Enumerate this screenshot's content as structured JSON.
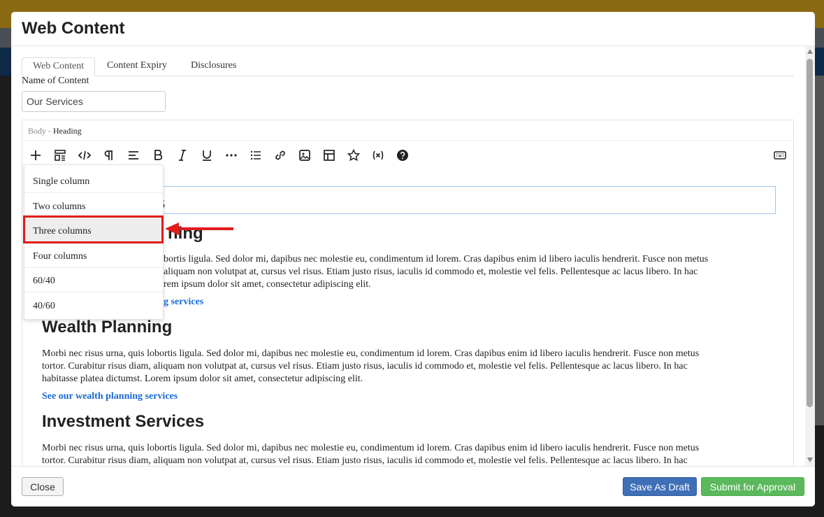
{
  "modal": {
    "title": "Web Content"
  },
  "tabs": [
    {
      "label": "Web Content",
      "active": true
    },
    {
      "label": "Content Expiry",
      "active": false
    },
    {
      "label": "Disclosures",
      "active": false
    }
  ],
  "form": {
    "name_label": "Name of Content",
    "name_value": "Our Services"
  },
  "editor": {
    "crumb_root": "Body",
    "crumb_sep": "-",
    "crumb_current": "Heading",
    "toolbar_icons": [
      "plus-icon",
      "layout-icon",
      "code-icon",
      "paragraph-icon",
      "align-icon",
      "bold-icon",
      "italic-icon",
      "underline-icon",
      "more-icon",
      "list-icon",
      "link-icon",
      "image-icon",
      "table-icon",
      "star-icon",
      "variable-icon",
      "help-icon",
      "keyboard-icon"
    ]
  },
  "content": {
    "heading_fragment": "s",
    "section1_heading_fragment": "ning",
    "section1_para_lines": [
      "bortis ligula. Sed dolor mi, dapibus nec molestie eu, condimentum id lorem. Cras dapibus enim id libero iaculis hendrerit. Fusce non metus",
      "aliquam non volutpat at, cursus vel risus. Etiam justo risus, iaculis id commodo et, molestie vel felis. Pellentesque ac lacus libero. In hac",
      "rem ipsum dolor sit amet, consectetur adipiscing elit."
    ],
    "section1_link_fragment": "g services",
    "section2_heading": "Wealth Planning",
    "section2_para_lines": [
      "Morbi nec risus urna, quis lobortis ligula. Sed dolor mi, dapibus nec molestie eu, condimentum id lorem. Cras dapibus enim id libero iaculis hendrerit. Fusce non metus",
      "tortor. Curabitur risus diam, aliquam non volutpat at, cursus vel risus. Etiam justo risus, iaculis id commodo et, molestie vel felis. Pellentesque ac lacus libero. In hac",
      "habitasse platea dictumst. Lorem ipsum dolor sit amet, consectetur adipiscing elit."
    ],
    "section2_link": "See our wealth planning services",
    "section3_heading": "Investment Services",
    "section3_para_lines": [
      "Morbi nec risus urna, quis lobortis ligula. Sed dolor mi, dapibus nec molestie eu, condimentum id lorem. Cras dapibus enim id libero iaculis hendrerit. Fusce non metus",
      "tortor. Curabitur risus diam, aliquam non volutpat at, cursus vel risus. Etiam justo risus, iaculis id commodo et, molestie vel felis. Pellentesque ac lacus libero. In hac"
    ]
  },
  "layout_menu": {
    "items": [
      "Single column",
      "Two columns",
      "Three columns",
      "Four columns",
      "60/40",
      "40/60"
    ],
    "highlighted": "Three columns"
  },
  "footer": {
    "close_label": "Close",
    "draft_label": "Save As Draft",
    "submit_label": "Submit for Approval"
  },
  "colors": {
    "draft_button": "#3f6fb6",
    "submit_button": "#5cb85c",
    "link": "#1a6ad6",
    "annotation": "#e21b1b"
  }
}
